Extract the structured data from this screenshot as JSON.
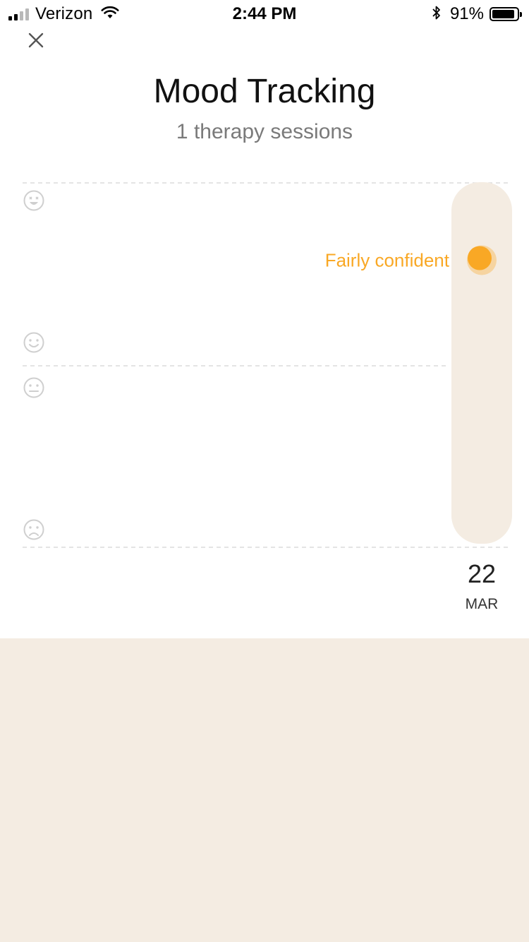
{
  "status_bar": {
    "carrier": "Verizon",
    "time": "2:44 PM",
    "battery_percent": "91%",
    "signal_bars_active": 2,
    "signal_bars_total": 4,
    "battery_level": 0.91,
    "icons": [
      "signal-icon",
      "wifi-icon",
      "bluetooth-icon",
      "battery-icon"
    ]
  },
  "header": {
    "close_icon": "close-icon",
    "title": "Mood Tracking",
    "subtitle": "1 therapy sessions"
  },
  "chart_data": {
    "type": "scatter",
    "mood_levels": [
      "very happy",
      "happy",
      "neutral",
      "sad"
    ],
    "mood_icons": [
      "very-happy-face-icon",
      "happy-face-icon",
      "neutral-face-icon",
      "sad-face-icon"
    ],
    "sessions": [
      {
        "day": "22",
        "month": "MAR",
        "mood_label": "Fairly confident",
        "mood_value": 0.82
      }
    ],
    "y_range": [
      0,
      1
    ],
    "grid": true
  },
  "colors": {
    "accent": "#f9a825",
    "track": "#f4ece2",
    "grid": "#dcdcdc",
    "face_icon": "#cfcfcf",
    "bottom_panel": "#f4ece2"
  }
}
